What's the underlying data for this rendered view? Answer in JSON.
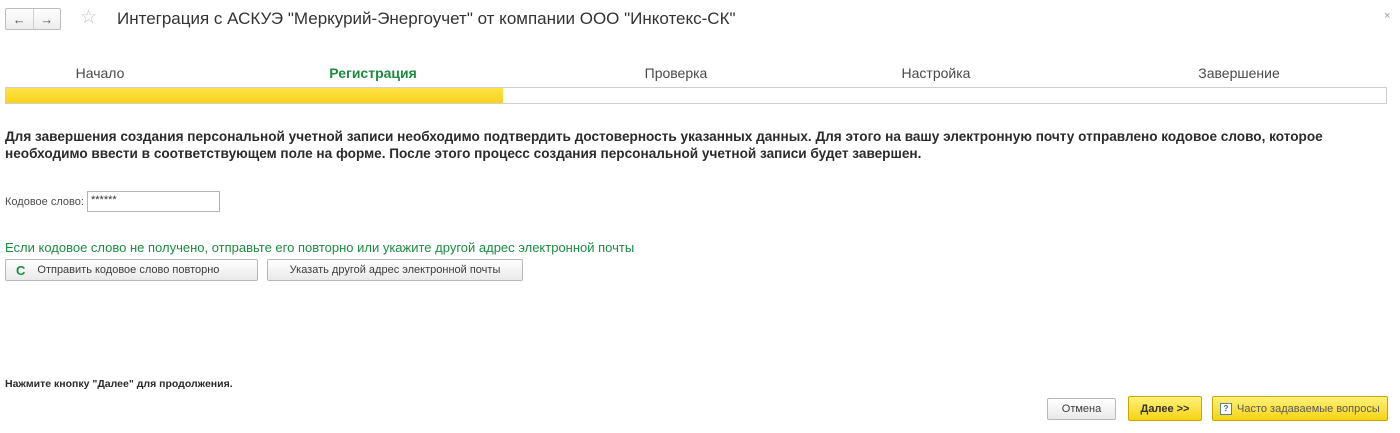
{
  "window": {
    "title": "Интеграция с АСКУЭ \"Меркурий-Энергоучет\" от компании ООО \"Инкотекс-СК\"",
    "back_glyph": "←",
    "forward_glyph": "→",
    "star_glyph": "☆",
    "close_glyph": "×"
  },
  "steps": [
    {
      "label": "Начало",
      "active": false
    },
    {
      "label": "Регистрация",
      "active": true
    },
    {
      "label": "Проверка",
      "active": false
    },
    {
      "label": "Настройка",
      "active": false
    },
    {
      "label": "Завершение",
      "active": false
    }
  ],
  "progress": {
    "fraction": 0.36,
    "fill_color": "#f8d21a"
  },
  "info_text": "Для завершения создания персональной учетной записи необходимо подтвердить достоверность указанных данных. Для этого на вашу электронную почту отправлено кодовое слово, которое необходимо ввести в соответствующем поле на форме. После этого процесс создания персональной учетной записи будет завершен.",
  "code_field": {
    "label": "Кодовое слово:",
    "value": "******"
  },
  "hint_text": "Если кодовое слово не получено, отправьте его повторно или укажите другой адрес электронной почты",
  "buttons": {
    "resend": {
      "label": "Отправить кодовое слово повторно",
      "icon_glyph": "C",
      "icon": "refresh-icon"
    },
    "other_email": {
      "label": "Указать другой адрес электронной почты"
    },
    "cancel": {
      "label": "Отмена"
    },
    "next": {
      "label": "Далее >>"
    },
    "faq": {
      "label": "Часто задаваемые вопросы",
      "icon_glyph": "?",
      "icon": "question-icon"
    }
  },
  "next_hint": "Нажмите кнопку \"Далее\" для продолжения.",
  "colors": {
    "accent_green": "#1c8c40",
    "accent_yellow": "#f8d21a"
  }
}
